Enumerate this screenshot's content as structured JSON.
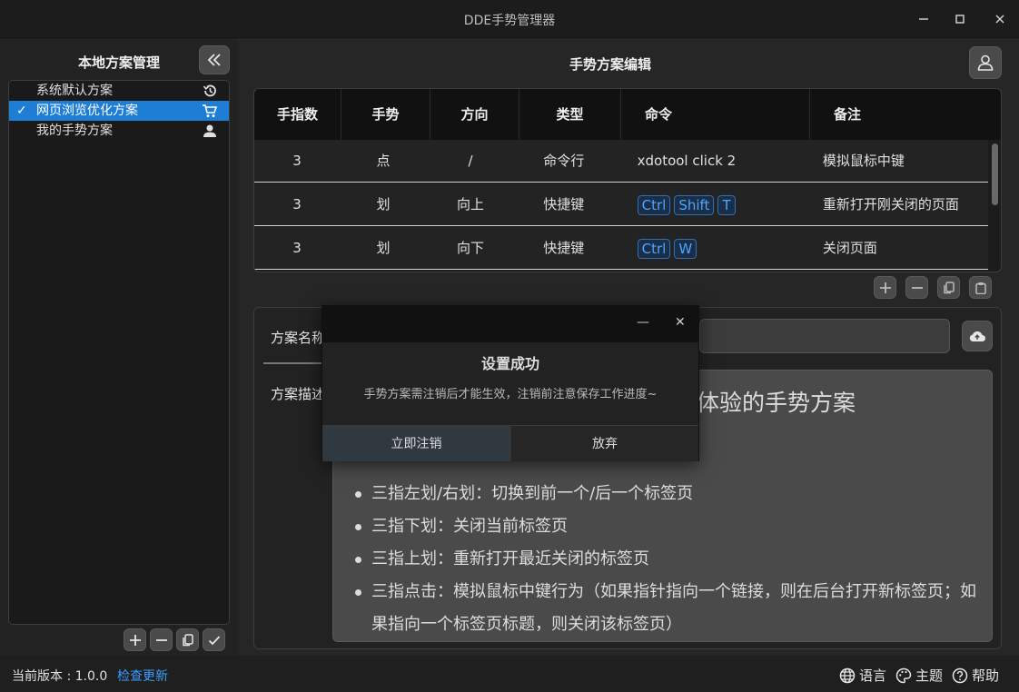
{
  "window": {
    "title": "DDE手势管理器",
    "min": "—",
    "max": "☐",
    "close": "✕"
  },
  "left": {
    "title": "本地方案管理",
    "items": [
      {
        "label": "系统默认方案",
        "icon": "history-icon",
        "selected": false
      },
      {
        "label": "网页浏览优化方案",
        "icon": "cart-icon",
        "selected": true
      },
      {
        "label": "我的手势方案",
        "icon": "person-icon",
        "selected": false
      }
    ],
    "tools": [
      "plus-icon",
      "minus-icon",
      "copy-icon",
      "check-icon"
    ]
  },
  "right": {
    "title": "手势方案编辑",
    "table": {
      "headers": [
        "手指数",
        "手势",
        "方向",
        "类型",
        "命令",
        "备注"
      ],
      "rows": [
        {
          "fingers": "3",
          "gesture": "点",
          "direction": "/",
          "type": "命令行",
          "command": "xdotool click 2",
          "keys": [],
          "note": "模拟鼠标中键"
        },
        {
          "fingers": "3",
          "gesture": "划",
          "direction": "向上",
          "type": "快捷键",
          "command": "",
          "keys": [
            "Ctrl",
            "Shift",
            "T"
          ],
          "note": "重新打开刚关闭的页面"
        },
        {
          "fingers": "3",
          "gesture": "划",
          "direction": "向下",
          "type": "快捷键",
          "command": "",
          "keys": [
            "Ctrl",
            "W"
          ],
          "note": "关闭页面"
        }
      ]
    },
    "editor": {
      "name_label": "方案名称",
      "desc_label": "方案描述",
      "desc_heading": "体验的手势方案",
      "desc_items": [
        "三指左划/右划：切换到前一个/后一个标签页",
        "三指下划：关闭当前标签页",
        "三指上划：重新打开最近关闭的标签页",
        "三指点击：模拟鼠标中键行为（如果指针指向一个链接，则在后台打开新标签页；如果指向一个标签页标题，则关闭该标签页）"
      ]
    }
  },
  "dialog": {
    "title": "设置成功",
    "message": "手势方案需注销后才能生效，注销前注意保存工作进度~",
    "ok": "立即注销",
    "cancel": "放弃"
  },
  "status": {
    "version": "当前版本 : 1.0.0",
    "update": "检查更新",
    "language": "语言",
    "theme": "主题",
    "help": "帮助"
  }
}
